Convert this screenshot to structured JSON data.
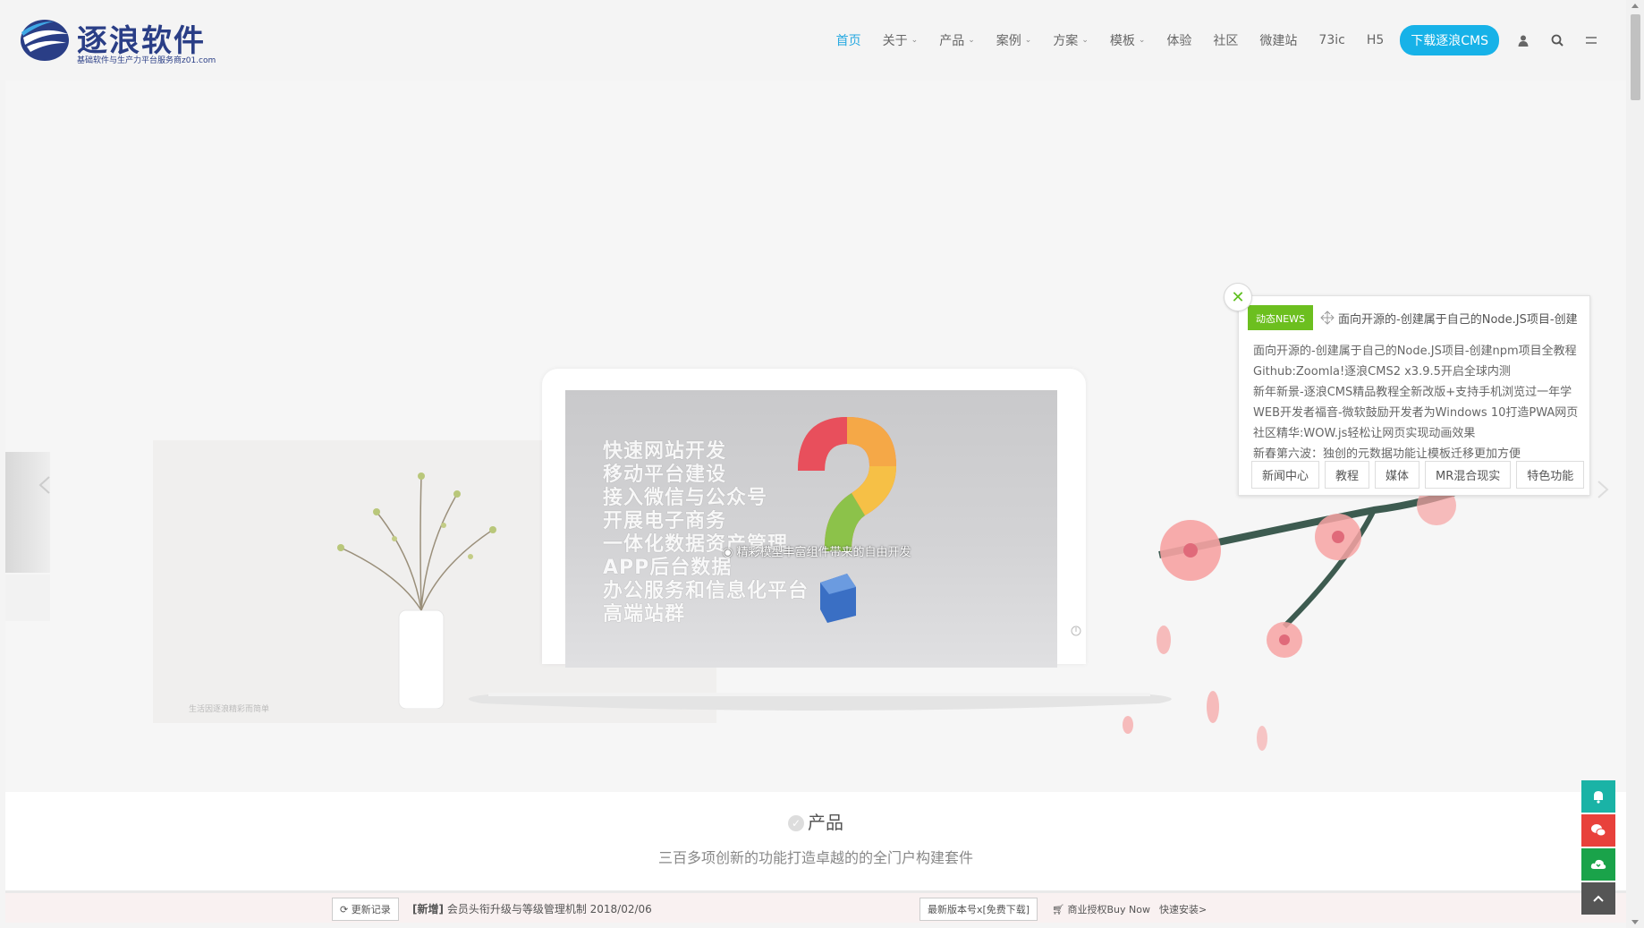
{
  "logo": {
    "name": "逐浪软件",
    "tagline": "基础软件与生产力平台服务商z01.com"
  },
  "nav": {
    "items": [
      {
        "label": "首页",
        "active": true,
        "dropdown": false
      },
      {
        "label": "关于",
        "active": false,
        "dropdown": true
      },
      {
        "label": "产品",
        "active": false,
        "dropdown": true
      },
      {
        "label": "案例",
        "active": false,
        "dropdown": true
      },
      {
        "label": "方案",
        "active": false,
        "dropdown": true
      },
      {
        "label": "模板",
        "active": false,
        "dropdown": true
      },
      {
        "label": "体验",
        "active": false,
        "dropdown": false
      },
      {
        "label": "社区",
        "active": false,
        "dropdown": false
      },
      {
        "label": "微建站",
        "active": false,
        "dropdown": false
      },
      {
        "label": "73ic",
        "active": false,
        "dropdown": false
      },
      {
        "label": "H5",
        "active": false,
        "dropdown": false
      }
    ],
    "cta": "下载逐浪CMS",
    "icons": [
      "user-icon",
      "search-icon",
      "menu-icon"
    ]
  },
  "hero": {
    "screen_lines": [
      "快速网站开发",
      "移动平台建设",
      "接入微信与公众号",
      "开展电子商务",
      "一体化数据资产管理",
      "APP后台数据",
      "办公服务和信息化平台",
      "高端站群"
    ],
    "overlay_text": "精彩模型丰富组件带来的自由开发",
    "left_caption": "生活因逐浪精彩而简单",
    "slide_count": 5,
    "active_slide": 0
  },
  "news_popup": {
    "badge": "动态NEWS",
    "headline": "面向开源的-创建属于自己的Node.JS项目-创建",
    "items": [
      "面向开源的-创建属于自己的Node.JS项目-创建npm项目全教程",
      "Github:Zoomla!逐浪CMS2 x3.9.5开启全球内测",
      "新年新景-逐浪CMS精品教程全新改版+支持手机浏览过一年学",
      "WEB开发者福音-微软鼓励开发者为Windows 10打造PWA网页",
      "社区精华:WOW.js轻松让网页实现动画效果",
      "新春第六波：独创的元数据功能让模板迁移更加方便"
    ],
    "tabs": [
      "新闻中心",
      "教程",
      "媒体",
      "MR混合现实",
      "特色功能"
    ],
    "close_symbol": "✕"
  },
  "products": {
    "title": "产品",
    "subtitle": "三百多项创新的功能打造卓越的的全门户构建套件"
  },
  "footer_bar": {
    "changelog_label": "更新记录",
    "news_tag": "[新增]",
    "news_text": "会员头衔升级与等级管理机制 2018/02/06",
    "version_label": "最新版本号x[免费下载]",
    "buy_label": "商业授权Buy Now",
    "install_label": "快速安装>"
  },
  "side_tools": [
    {
      "icon": "bell-icon",
      "color": "#1ab3a6"
    },
    {
      "icon": "wechat-icon",
      "color": "#e8413b"
    },
    {
      "icon": "cloud-download-icon",
      "color": "#1aa34a"
    },
    {
      "icon": "arrow-up-icon",
      "color": "#555555"
    }
  ],
  "colors": {
    "accent": "#17b2e8",
    "nav_active": "#27a9e1",
    "news_badge": "#6cbf1f",
    "logo_blue": "#2a3e86"
  }
}
